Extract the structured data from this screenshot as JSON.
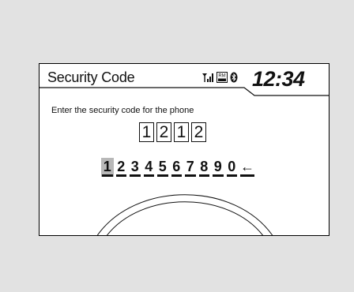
{
  "header": {
    "title": "Security Code",
    "clock": "12:34",
    "status_icons": [
      "signal-strength-icon",
      "roam-icon",
      "battery-icon",
      "bluetooth-icon"
    ],
    "roam_label": "RM"
  },
  "main": {
    "prompt": "Enter the security code for the phone",
    "entered_code": [
      "1",
      "2",
      "1",
      "2"
    ],
    "keypad": {
      "keys": [
        "1",
        "2",
        "3",
        "4",
        "5",
        "6",
        "7",
        "8",
        "9",
        "0"
      ],
      "selected_key": "1",
      "backspace_label": "←"
    }
  },
  "colors": {
    "background": "#e2e2e2",
    "screen": "#ffffff",
    "text": "#111111",
    "selected_key": "#b8b8b8"
  }
}
